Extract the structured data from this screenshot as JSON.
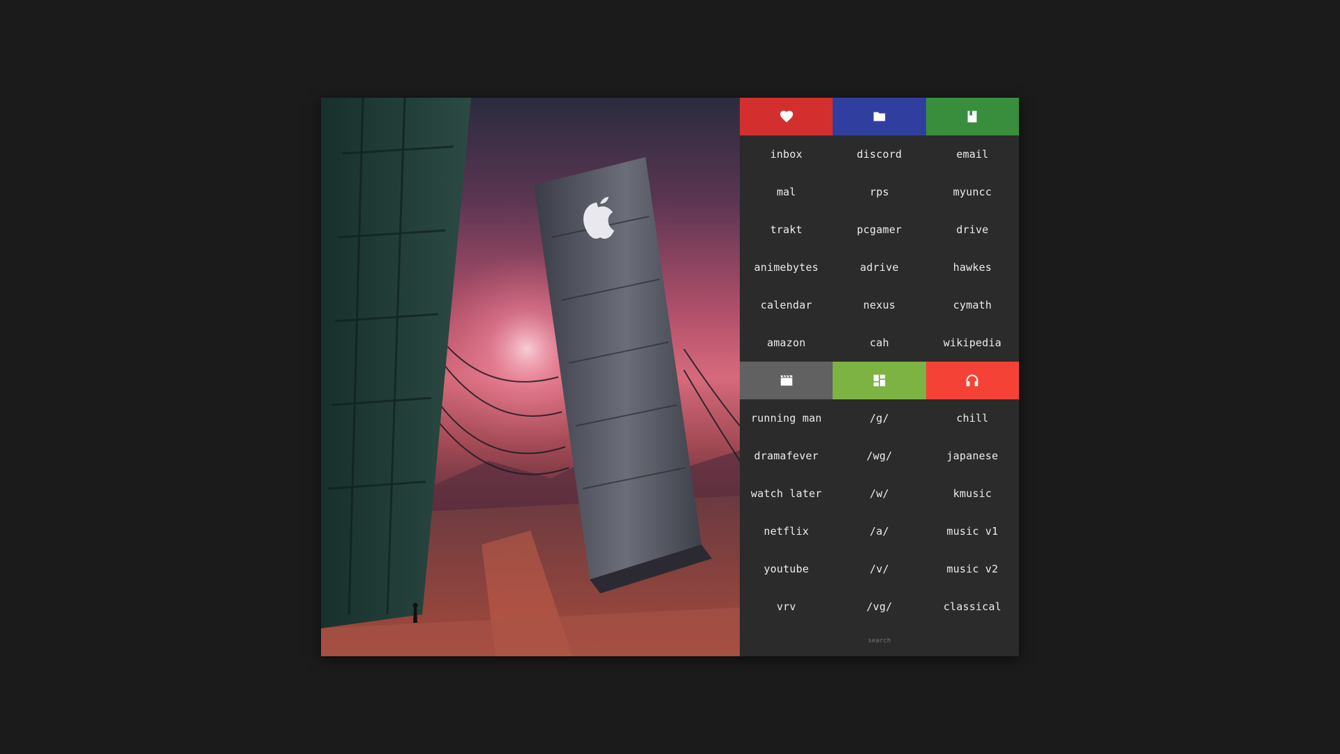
{
  "colors": {
    "background": "#1b1b1b",
    "panel": "#2b2b2b",
    "favorites_header": "#d32f2f",
    "folders_header": "#303f9f",
    "bookmarks_header": "#388e3c",
    "video_header": "#616161",
    "boards_header": "#7cb342",
    "music_header": "#f44336"
  },
  "sections": [
    {
      "headers": [
        {
          "icon": "heart-icon",
          "color": "#d32f2f"
        },
        {
          "icon": "folder-icon",
          "color": "#303f9f"
        },
        {
          "icon": "bookmark-icon",
          "color": "#388e3c"
        }
      ],
      "columns": [
        [
          "inbox",
          "mal",
          "trakt",
          "animebytes",
          "calendar",
          "amazon"
        ],
        [
          "discord",
          "rps",
          "pcgamer",
          "adrive",
          "nexus",
          "cah"
        ],
        [
          "email",
          "myuncc",
          "drive",
          "hawkes",
          "cymath",
          "wikipedia"
        ]
      ]
    },
    {
      "headers": [
        {
          "icon": "clapperboard-icon",
          "color": "#616161"
        },
        {
          "icon": "dashboard-icon",
          "color": "#7cb342"
        },
        {
          "icon": "headphones-icon",
          "color": "#f44336"
        }
      ],
      "columns": [
        [
          "running man",
          "dramafever",
          "watch later",
          "netflix",
          "youtube",
          "vrv"
        ],
        [
          "/g/",
          "/wg/",
          "/w/",
          "/a/",
          "/v/",
          "/vg/"
        ],
        [
          "chill",
          "japanese",
          "kmusic",
          "music v1",
          "music v2",
          "classical"
        ]
      ]
    }
  ],
  "search": {
    "placeholder": "search"
  }
}
